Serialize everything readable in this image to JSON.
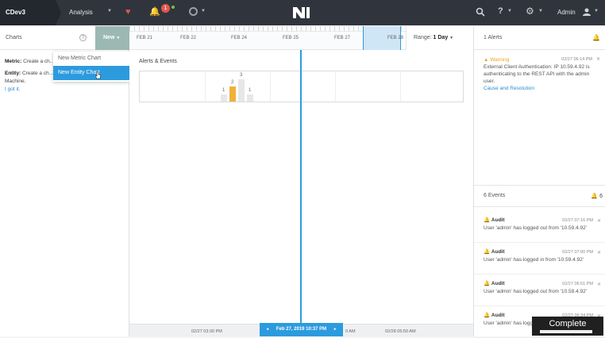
{
  "topbar": {
    "cluster": "CDev3",
    "nav": "Analysis",
    "alert_count": "1",
    "user": "Admin",
    "help": "?"
  },
  "left": {
    "title": "Charts",
    "new_label": "New",
    "menu": [
      "New Metric Chart",
      "New Entity Chart"
    ],
    "metric_label": "Metric:",
    "metric_text": "Create a ch... on metrics like IOP...",
    "entity_label": "Entity:",
    "entity_text": "Create a ch... entity like a Host or a Virtual Machine.",
    "got_it": "I got it."
  },
  "timeline": {
    "labels": [
      "FEB 21",
      "FEB 22",
      "FEB 24",
      "FEB 25",
      "FEB 27",
      "FEB 28"
    ],
    "range_label": "Range:",
    "range_value": "1 Day"
  },
  "chart_data": {
    "type": "bar",
    "title": "Alerts & Events",
    "categories": [
      "1",
      "2",
      "3",
      "4"
    ],
    "values": [
      1,
      2,
      3,
      1
    ],
    "colors": [
      "#e7e7e7",
      "#f0b13a",
      "#e7e7e7",
      "#e7e7e7"
    ]
  },
  "axis": {
    "left_label": "02/27 03:30 PM",
    "now": "Feb 27, 2019 10:37 PM",
    "mid_label": "0 AM",
    "right_label": "02/28 05:50 AM"
  },
  "alerts": {
    "title": "1 Alerts",
    "severity": "Warning",
    "time": "02/27 06:14 PM",
    "text": "External Client Authentication: IP 10.59.4.92 is authenticating to the REST API with the admin user.",
    "link": "Cause and Resolution"
  },
  "events": {
    "title": "6 Events",
    "count": "6",
    "items": [
      {
        "type": "Audit",
        "time": "02/27 07:16 PM",
        "text": "User 'admin' has logged out from '10.59.4.92'"
      },
      {
        "type": "Audit",
        "time": "02/27 07:00 PM",
        "text": "User 'admin' has logged in from '10.59.4.92'"
      },
      {
        "type": "Audit",
        "time": "02/27 06:51 PM",
        "text": "User 'admin' has logged out from '10.59.4.92'"
      },
      {
        "type": "Audit",
        "time": "02/27 06:34 PM",
        "text": "User 'admin' has logged in from '10.59.4.92'"
      }
    ]
  },
  "overlay": {
    "complete": "Complete"
  }
}
